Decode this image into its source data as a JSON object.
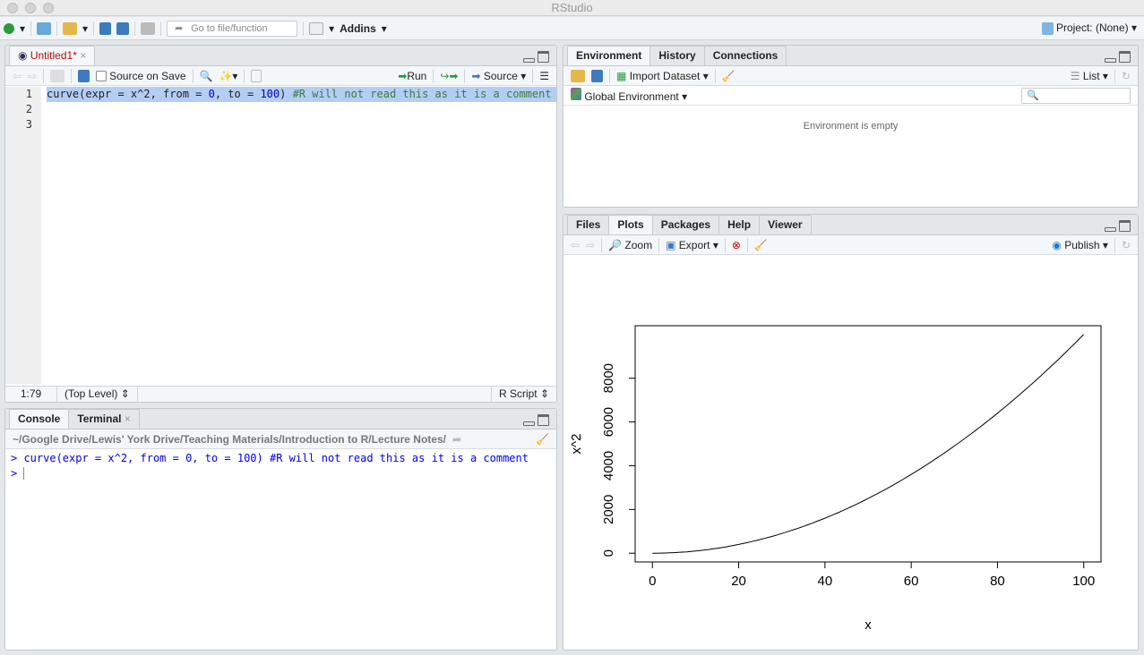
{
  "window": {
    "title": "RStudio"
  },
  "toolbar": {
    "goto_placeholder": "Go to file/function",
    "addins": "Addins",
    "project": "Project: (None)"
  },
  "source": {
    "tab": "Untitled1*",
    "source_on_save": "Source on Save",
    "run": "Run",
    "source": "Source",
    "lines": [
      "1",
      "2",
      "3"
    ],
    "code": {
      "fn": "curve(expr = x^2, from = ",
      "n0": "0",
      ", to = ": ", to = ",
      "n100": "100",
      ") ": ") ",
      "comment": "#R will not read this as it is a comment"
    },
    "status": {
      "pos": "1:79",
      "scope": "(Top Level) ⇕",
      "type": "R Script ⇕"
    }
  },
  "console": {
    "tabs": [
      "Console",
      "Terminal"
    ],
    "path": "~/Google Drive/Lewis' York Drive/Teaching Materials/Introduction to R/Lecture Notes/",
    "lines": [
      "> curve(expr = x^2, from = 0, to = 100) #R will not read this as it is a comment",
      "> "
    ]
  },
  "env": {
    "tabs": [
      "Environment",
      "History",
      "Connections"
    ],
    "import": "Import Dataset",
    "list": "List",
    "scope": "Global Environment",
    "empty": "Environment is empty"
  },
  "plots": {
    "tabs": [
      "Files",
      "Plots",
      "Packages",
      "Help",
      "Viewer"
    ],
    "zoom": "Zoom",
    "export": "Export",
    "publish": "Publish"
  },
  "chart_data": {
    "type": "line",
    "expression": "x^2",
    "xlabel": "x",
    "ylabel": "x^2",
    "xlim": [
      0,
      100
    ],
    "ylim": [
      0,
      10000
    ],
    "xticks": [
      "0",
      "20",
      "40",
      "60",
      "80",
      "100"
    ],
    "yticks": [
      "0",
      "2000",
      "4000",
      "6000",
      "8000"
    ],
    "grid": false
  }
}
